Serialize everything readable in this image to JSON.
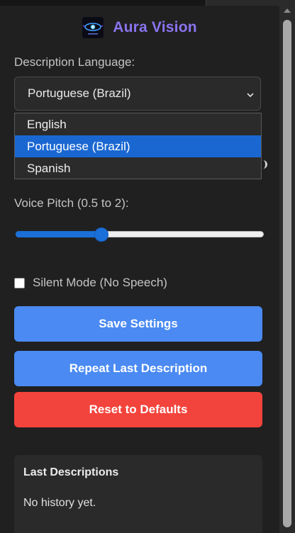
{
  "app": {
    "title": "Aura Vision",
    "logo_icon": "aura-eye-logo-icon",
    "accent_color": "#8a74f0"
  },
  "language": {
    "label": "Description Language:",
    "selected": "Portuguese (Brazil)",
    "options": [
      "English",
      "Portuguese (Brazil)",
      "Spanish"
    ],
    "dropdown_open": true,
    "chevron_icon": "chevron-down-icon"
  },
  "pitch": {
    "label": "Voice Pitch (0.5 to 2):",
    "min": 0.5,
    "max": 2,
    "value": 1.0,
    "color": "#1a6fd8"
  },
  "silent_mode": {
    "label": "Silent Mode (No Speech)",
    "checked": false
  },
  "buttons": {
    "save": "Save Settings",
    "repeat": "Repeat Last Description",
    "reset": "Reset to Defaults",
    "primary_color": "#4a8af2",
    "danger_color": "#f2443c"
  },
  "history": {
    "title": "Last Descriptions",
    "empty_text": "No history yet."
  }
}
